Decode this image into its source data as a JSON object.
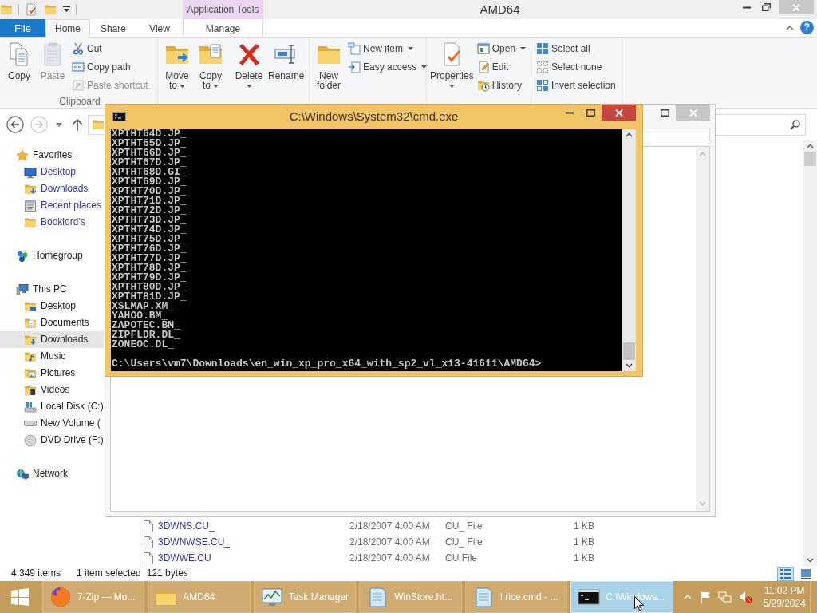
{
  "explorer": {
    "title": "AMD64",
    "contextual_group": "Application Tools",
    "tabs": [
      {
        "label": "File",
        "kind": "backstage",
        "selected": false
      },
      {
        "label": "Home",
        "kind": "tab",
        "selected": true
      },
      {
        "label": "Share",
        "kind": "tab",
        "selected": false
      },
      {
        "label": "View",
        "kind": "tab",
        "selected": false
      },
      {
        "label": "Manage",
        "kind": "contextual",
        "selected": false
      }
    ],
    "help_button": "?",
    "ribbon_groups": [
      {
        "label": "Clipboard",
        "commands": [
          {
            "label": "Copy",
            "kind": "large",
            "dropdown": false,
            "disabled": false
          },
          {
            "label": "Paste",
            "kind": "large",
            "dropdown": false,
            "disabled": true
          },
          {
            "label": "Cut",
            "kind": "small",
            "dropdown": false,
            "disabled": false
          },
          {
            "label": "Copy path",
            "kind": "small",
            "dropdown": false,
            "disabled": false
          },
          {
            "label": "Paste shortcut",
            "kind": "small",
            "dropdown": false,
            "disabled": true
          }
        ]
      },
      {
        "commands": [
          {
            "label": "Move to",
            "kind": "large",
            "dropdown": true,
            "disabled": false
          },
          {
            "label": "Copy to",
            "kind": "large",
            "dropdown": true,
            "disabled": false
          },
          {
            "label": "Delete",
            "kind": "large",
            "dropdown": true,
            "disabled": false
          },
          {
            "label": "Rename",
            "kind": "large",
            "dropdown": false,
            "disabled": false
          }
        ]
      },
      {
        "commands": [
          {
            "label": "New folder",
            "kind": "large",
            "dropdown": false,
            "disabled": false
          },
          {
            "label": "New item",
            "kind": "small",
            "dropdown": true,
            "disabled": false
          },
          {
            "label": "Easy access",
            "kind": "small",
            "dropdown": true,
            "disabled": false
          }
        ]
      },
      {
        "commands": [
          {
            "label": "Properties",
            "kind": "large",
            "dropdown": true,
            "disabled": false
          },
          {
            "label": "Open",
            "kind": "small",
            "dropdown": true,
            "disabled": false
          },
          {
            "label": "Edit",
            "kind": "small",
            "dropdown": false,
            "disabled": false
          },
          {
            "label": "History",
            "kind": "small",
            "dropdown": false,
            "disabled": false
          }
        ]
      },
      {
        "commands": [
          {
            "label": "Select all",
            "kind": "small",
            "dropdown": false,
            "disabled": false
          },
          {
            "label": "Select none",
            "kind": "small",
            "dropdown": false,
            "disabled": false
          },
          {
            "label": "Invert selection",
            "kind": "small",
            "dropdown": false,
            "disabled": false
          }
        ]
      }
    ],
    "nav": [
      {
        "label": "Favorites",
        "selected": false,
        "children": [
          {
            "label": "Desktop",
            "selected": false,
            "color": "#3333c4"
          },
          {
            "label": "Downloads",
            "selected": false,
            "color": "#3333c4"
          },
          {
            "label": "Recent places",
            "selected": false,
            "color": "#3333c4"
          },
          {
            "label": "Booklord's",
            "selected": false,
            "color": "#3333c4"
          }
        ]
      },
      {
        "label": "Homegroup",
        "selected": false
      },
      {
        "label": "This PC",
        "selected": false,
        "children": [
          {
            "label": "Desktop",
            "selected": false
          },
          {
            "label": "Documents",
            "selected": false
          },
          {
            "label": "Downloads",
            "selected": true
          },
          {
            "label": "Music",
            "selected": false
          },
          {
            "label": "Pictures",
            "selected": false
          },
          {
            "label": "Videos",
            "selected": false
          },
          {
            "label": "Local Disk (C:)",
            "selected": false
          },
          {
            "label": "New Volume (",
            "selected": false
          },
          {
            "label": "DVD Drive (F:)",
            "selected": false
          }
        ]
      },
      {
        "label": "Network",
        "selected": false
      }
    ],
    "file_rows": [
      {
        "cells": [
          "3DWNS.CU_",
          "2/18/2007 4:00 AM",
          "CU_ File",
          "1 KB"
        ]
      },
      {
        "cells": [
          "3DWNWSE.CU_",
          "2/18/2007 4:00 AM",
          "CU_ File",
          "1 KB"
        ]
      },
      {
        "cells": [
          "3DWWE.CU",
          "2/18/2007 4:00 AM",
          "CU File",
          "1 KB"
        ]
      }
    ],
    "status": {
      "items": "4,349 items",
      "selection": "1 item selected",
      "size": "121 bytes"
    },
    "views": [
      {
        "selected": true
      },
      {
        "selected": false
      }
    ]
  },
  "console": {
    "title": "C:\\Windows\\System32\\cmd.exe",
    "lines": [
      "XPTHT64D.JP_",
      "XPTHT65D.JP_",
      "XPTHT66D.JP_",
      "XPTHT67D.JP_",
      "XPTHT68D.GI_",
      "XPTHT69D.JP_",
      "XPTHT70D.JP_",
      "XPTHT71D.JP_",
      "XPTHT72D.JP_",
      "XPTHT73D.JP_",
      "XPTHT74D.JP_",
      "XPTHT75D.JP_",
      "XPTHT76D.JP_",
      "XPTHT77D.JP_",
      "XPTHT78D.JP_",
      "XPTHT79D.JP_",
      "XPTHT80D.JP_",
      "XPTHT81D.JP_",
      "XSLMAP.XM_",
      "YAHOO.BM_",
      "ZAPOTEC.BM_",
      "ZIPFLDR.DL_",
      "ZONEOC.DL_"
    ],
    "prompt": "C:\\Users\\vm7\\Downloads\\en_win_xp_pro_x64_with_sp2_vl_x13-41611\\AMD64>"
  },
  "taskbar": {
    "items": [
      {
        "label": "7-Zip — Mo...",
        "selected": false
      },
      {
        "label": "AMD64",
        "selected": false
      },
      {
        "label": "Task Manager",
        "selected": false
      },
      {
        "label": "WinStore.ht...",
        "selected": false
      },
      {
        "label": "! rice.cmd - ...",
        "selected": false
      },
      {
        "label": "C:\\Windows...",
        "selected": true
      }
    ],
    "clock": {
      "time": "11:02 PM",
      "date": "5/29/2024"
    }
  }
}
